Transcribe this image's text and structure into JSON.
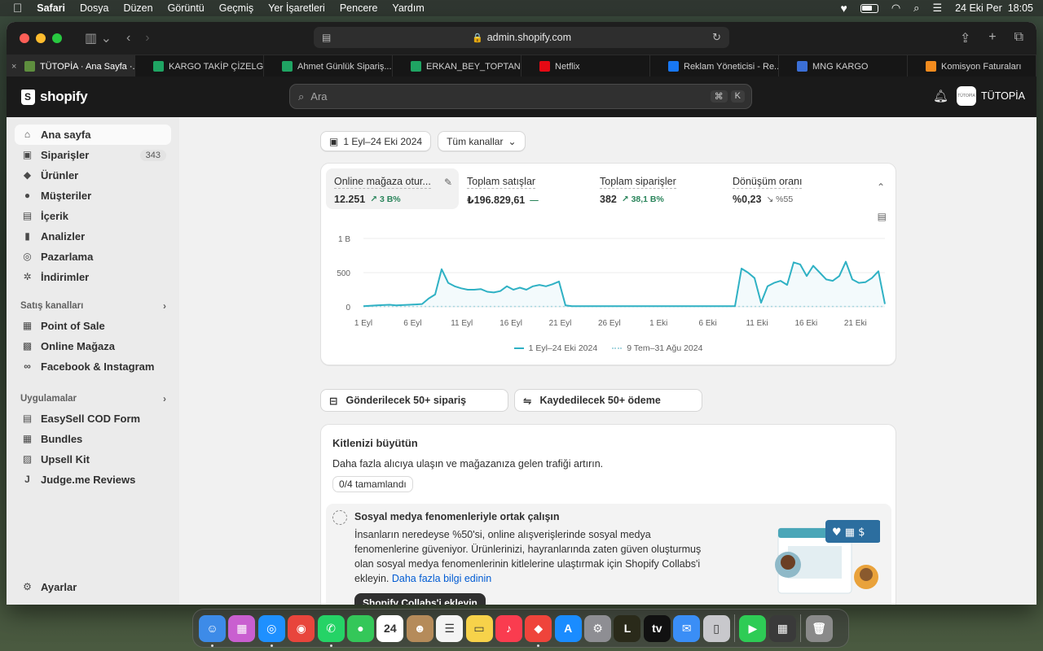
{
  "menubar": {
    "app": "Safari",
    "items": [
      "Dosya",
      "Düzen",
      "Görüntü",
      "Geçmiş",
      "Yer İşaretleri",
      "Pencere",
      "Yardım"
    ],
    "datetime": "24 Eki Per  18:05"
  },
  "browser": {
    "url": "admin.shopify.com",
    "tabs": [
      {
        "title": "TÜTOPİA · Ana Sayfa ·...",
        "icon": "shopify-icon",
        "color": "#5e8e3e"
      },
      {
        "title": "KARGO TAKİP ÇİZELG...",
        "icon": "sheets-icon",
        "color": "#1fa463"
      },
      {
        "title": "Ahmet Günlük Sipariş...",
        "icon": "sheets-icon",
        "color": "#1fa463"
      },
      {
        "title": "ERKAN_BEY_TOPTAN...",
        "icon": "sheets-icon",
        "color": "#1fa463"
      },
      {
        "title": "Netflix",
        "icon": "netflix-icon",
        "color": "#e50914"
      },
      {
        "title": "Reklam Yöneticisi - Re...",
        "icon": "facebook-icon",
        "color": "#1877f2"
      },
      {
        "title": "MNG KARGO",
        "icon": "mng-icon",
        "color": "#3b6fd6"
      },
      {
        "title": "Komisyon Faturaları",
        "icon": "doc-icon",
        "color": "#f28b1e"
      }
    ]
  },
  "shopify": {
    "brand": "shopify",
    "search_placeholder": "Ara",
    "shortcut": [
      "⌘",
      "K"
    ],
    "store_name": "TÜTOPİA",
    "store_logo_text": "TÜTOPİA"
  },
  "sidebar": {
    "items": [
      {
        "label": "Ana sayfa",
        "icon": "home-icon",
        "active": true
      },
      {
        "label": "Siparişler",
        "icon": "orders-icon",
        "badge": "343"
      },
      {
        "label": "Ürünler",
        "icon": "tag-icon"
      },
      {
        "label": "Müşteriler",
        "icon": "person-icon"
      },
      {
        "label": "İçerik",
        "icon": "image-icon"
      },
      {
        "label": "Analizler",
        "icon": "analytics-icon"
      },
      {
        "label": "Pazarlama",
        "icon": "target-icon"
      },
      {
        "label": "İndirimler",
        "icon": "discount-icon"
      }
    ],
    "sales_channels_title": "Satış kanalları",
    "sales_channels": [
      {
        "label": "Point of Sale",
        "icon": "pos-icon"
      },
      {
        "label": "Online Mağaza",
        "icon": "store-icon"
      },
      {
        "label": "Facebook & Instagram",
        "icon": "meta-icon"
      }
    ],
    "apps_title": "Uygulamalar",
    "apps": [
      {
        "label": "EasySell COD Form",
        "icon": "easysell-icon"
      },
      {
        "label": "Bundles",
        "icon": "bundles-icon"
      },
      {
        "label": "Upsell Kit",
        "icon": "upsell-icon"
      },
      {
        "label": "Judge.me Reviews",
        "icon": "judgeme-icon"
      }
    ],
    "settings": "Ayarlar"
  },
  "filters": {
    "date_range": "1 Eyl–24 Eki 2024",
    "channel": "Tüm kanallar"
  },
  "metrics": [
    {
      "label": "Online mağaza otur...",
      "value": "12.251",
      "delta": "3 B%",
      "direction": "up"
    },
    {
      "label": "Toplam satışlar",
      "value": "₺196.829,61",
      "delta": "—",
      "direction": "none"
    },
    {
      "label": "Toplam siparişler",
      "value": "382",
      "delta": "38,1 B%",
      "direction": "up"
    },
    {
      "label": "Dönüşüm oranı",
      "value": "%0,23",
      "delta": "%55",
      "direction": "down"
    }
  ],
  "chart_data": {
    "type": "line",
    "x_labels": [
      "1 Eyl",
      "6 Eyl",
      "11 Eyl",
      "16 Eyl",
      "21 Eyl",
      "26 Eyl",
      "1 Eki",
      "6 Eki",
      "11 Eki",
      "16 Eki",
      "21 Eki"
    ],
    "y_ticks": [
      "0",
      "500",
      "1 B"
    ],
    "ylim": [
      0,
      1000
    ],
    "series": [
      {
        "name": "1 Eyl–24 Eki 2024",
        "color": "#2fb1c4",
        "values": [
          10,
          15,
          20,
          25,
          30,
          20,
          25,
          30,
          35,
          40,
          120,
          180,
          550,
          350,
          300,
          270,
          250,
          250,
          260,
          220,
          210,
          230,
          300,
          250,
          280,
          250,
          300,
          320,
          300,
          330,
          370,
          20,
          10,
          10,
          10,
          10,
          10,
          10,
          10,
          10,
          10,
          10,
          10,
          10,
          10,
          10,
          10,
          10,
          10,
          10,
          10,
          10,
          10,
          10,
          10,
          10,
          10,
          10,
          560,
          500,
          420,
          60,
          300,
          350,
          380,
          320,
          650,
          620,
          450,
          600,
          500,
          400,
          380,
          450,
          660,
          400,
          350,
          360,
          420,
          520,
          40
        ]
      },
      {
        "name": "9 Tem–31 Ağu 2024",
        "color": "#a9d7e0",
        "values": [
          5,
          5,
          5,
          5,
          5,
          5,
          5,
          5,
          5,
          5,
          5,
          5,
          5,
          5,
          5,
          5,
          5,
          5,
          5,
          5,
          5,
          5,
          5,
          5,
          5,
          5,
          5,
          5,
          5,
          5,
          5,
          5,
          5,
          5,
          5,
          5,
          5,
          5,
          5,
          5,
          5,
          5,
          5,
          5,
          5,
          5,
          5,
          5,
          5,
          5,
          5,
          5,
          5,
          5,
          5,
          5,
          5,
          5,
          5,
          5,
          5,
          5,
          5,
          5,
          5,
          5,
          5,
          5,
          5,
          5,
          5,
          5,
          5,
          5,
          5,
          5,
          5,
          5,
          5,
          5,
          5
        ]
      }
    ]
  },
  "actions": [
    {
      "label": "Gönderilecek 50+ sipariş",
      "icon": "inbox-icon"
    },
    {
      "label": "Kaydedilecek 50+ ödeme",
      "icon": "payment-icon"
    }
  ],
  "growth": {
    "title": "Kitlenizi büyütün",
    "subtitle": "Daha fazla alıcıya ulaşın ve mağazanıza gelen trafiği artırın.",
    "progress": "0/4 tamamlandı",
    "task_title": "Sosyal medya fenomenleriyle ortak çalışın",
    "task_desc": "İnsanların neredeyse %50'si, online alışverişlerinde sosyal medya fenomenlerine güveniyor. Ürünlerinizi, hayranlarında zaten güven oluşturmuş olan sosyal medya fenomenlerinin kitlelerine ulaştırmak için Shopify Collabs'i ekleyin.",
    "task_link": "Daha fazla bilgi edinin",
    "task_button": "Shopify Collabs'i ekleyin"
  },
  "dock": [
    {
      "name": "finder-icon",
      "color": "#3d8be8",
      "glyph": "☺"
    },
    {
      "name": "launchpad-icon",
      "color": "#c95fd0",
      "glyph": "▦"
    },
    {
      "name": "safari-icon",
      "color": "#1e90ff",
      "glyph": "◎"
    },
    {
      "name": "chrome-icon",
      "color": "#e8453c",
      "glyph": "◉"
    },
    {
      "name": "whatsapp-icon",
      "color": "#25d366",
      "glyph": "✆"
    },
    {
      "name": "messages-icon",
      "color": "#34c759",
      "glyph": "●"
    },
    {
      "name": "calendar-icon",
      "color": "#ffffff",
      "glyph": "24"
    },
    {
      "name": "contacts-icon",
      "color": "#b58b5a",
      "glyph": "☻"
    },
    {
      "name": "reminders-icon",
      "color": "#f4f4f4",
      "glyph": "☰"
    },
    {
      "name": "notes-icon",
      "color": "#f7d24a",
      "glyph": "▭"
    },
    {
      "name": "music-icon",
      "color": "#fa3c4f",
      "glyph": "♪"
    },
    {
      "name": "anydesk-icon",
      "color": "#ef443b",
      "glyph": "◆"
    },
    {
      "name": "appstore-icon",
      "color": "#1a8cff",
      "glyph": "A"
    },
    {
      "name": "settings-icon",
      "color": "#8e8e93",
      "glyph": "⚙"
    },
    {
      "name": "league-icon",
      "color": "#2a2a1a",
      "glyph": "L"
    },
    {
      "name": "appletv-icon",
      "color": "#111111",
      "glyph": "tv"
    },
    {
      "name": "mail-icon",
      "color": "#3a8ef6",
      "glyph": "✉"
    },
    {
      "name": "iphone-mirroring-icon",
      "color": "#c8c8cc",
      "glyph": "▯"
    },
    {
      "name": "facetime-icon",
      "color": "#2ecc55",
      "glyph": "▶"
    },
    {
      "name": "calculator-icon",
      "color": "#3a3a3a",
      "glyph": "▦"
    },
    {
      "name": "trash-icon",
      "color": "#8a8a8a",
      "glyph": "🗑"
    }
  ]
}
